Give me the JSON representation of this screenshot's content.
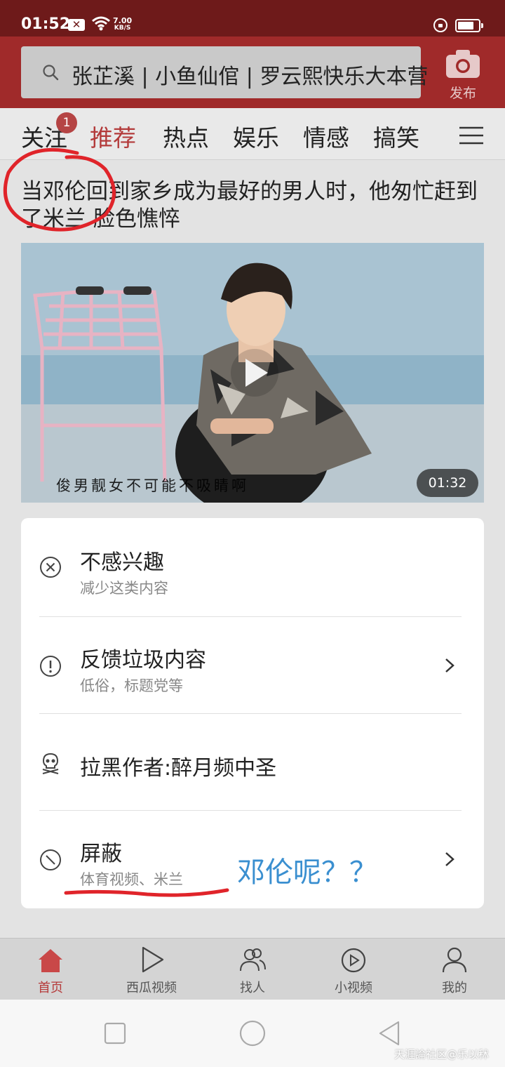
{
  "status_bar": {
    "time": "01:52",
    "net_speed_value": "7.00",
    "net_speed_unit": "KB/S"
  },
  "header": {
    "search_text": "张芷溪 | 小鱼仙倌 | 罗云熙快乐大本营",
    "publish_label": "发布"
  },
  "tabs": [
    {
      "label": "关注",
      "badge": "1"
    },
    {
      "label": "推荐",
      "active": true
    },
    {
      "label": "热点"
    },
    {
      "label": "娱乐"
    },
    {
      "label": "情感"
    },
    {
      "label": "搞笑"
    }
  ],
  "article": {
    "title": "当邓伦回到家乡成为最好的男人时，他匆忙赶到了米兰 脸色憔悴",
    "video_subtitle": "俊男靓女不可能不吸睛啊",
    "duration": "01:32"
  },
  "popup": {
    "options": [
      {
        "title": "不感兴趣",
        "subtitle": "减少这类内容",
        "icon": "close-circle-icon"
      },
      {
        "title": "反馈垃圾内容",
        "subtitle": "低俗，标题党等",
        "icon": "alert-circle-icon",
        "has_arrow": true
      },
      {
        "title": "拉黑作者:醉月频中圣",
        "icon": "skull-icon"
      },
      {
        "title": "屏蔽",
        "subtitle": "体育视频、米兰",
        "icon": "block-icon",
        "has_arrow": true
      }
    ]
  },
  "annotation": {
    "text": "邓伦呢？？"
  },
  "bottom_nav": [
    {
      "label": "首页",
      "icon": "home-icon",
      "active": true
    },
    {
      "label": "西瓜视频",
      "icon": "play-icon"
    },
    {
      "label": "找人",
      "icon": "people-icon"
    },
    {
      "label": "小视频",
      "icon": "short-video-icon"
    },
    {
      "label": "我的",
      "icon": "profile-icon"
    }
  ],
  "watermark": "天涯論社区@乐以秫",
  "colors": {
    "header_red": "#a02a2a",
    "accent_red": "#b33a3a",
    "annotation_blue": "#3a8fd0",
    "marker_red": "#e0242a"
  }
}
